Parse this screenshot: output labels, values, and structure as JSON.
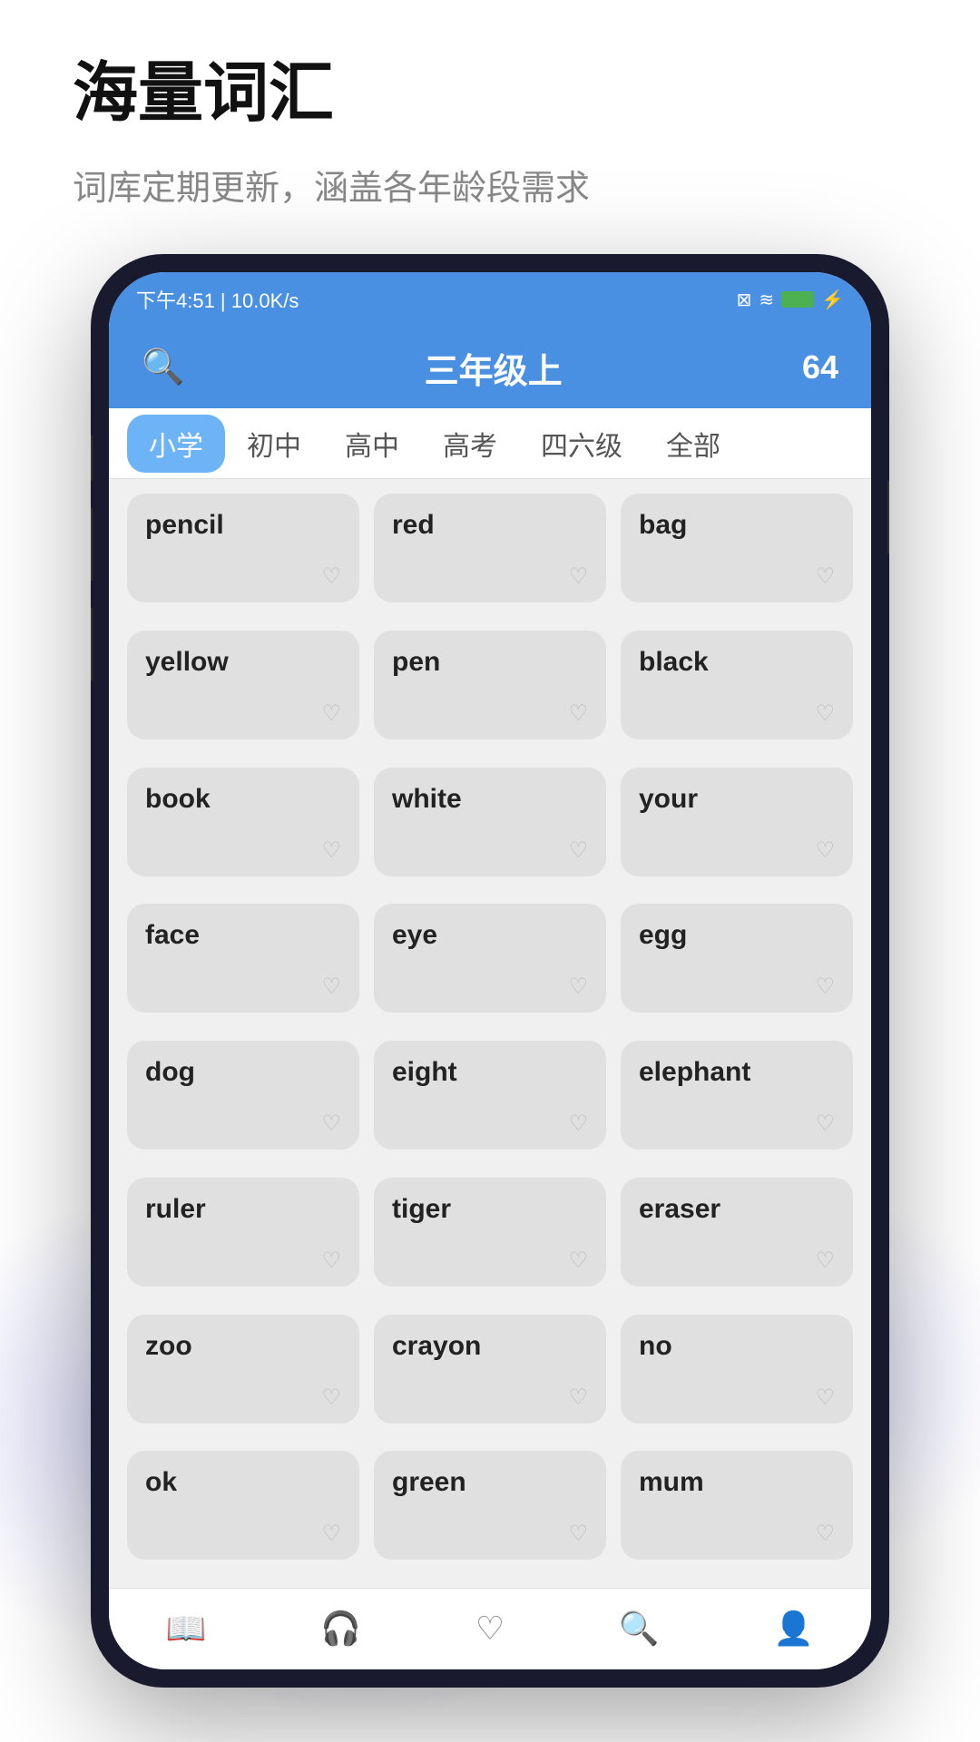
{
  "page": {
    "title": "海量词汇",
    "subtitle": "词库定期更新，涵盖各年龄段需求"
  },
  "statusBar": {
    "time": "下午4:51 | 10.0K/s",
    "icons": "⊠ ≋ 100"
  },
  "appHeader": {
    "title": "三年级上",
    "wordCount": "64",
    "searchLabel": "搜索"
  },
  "tabs": [
    {
      "label": "小学",
      "active": true
    },
    {
      "label": "初中",
      "active": false
    },
    {
      "label": "高中",
      "active": false
    },
    {
      "label": "高考",
      "active": false
    },
    {
      "label": "四六级",
      "active": false
    },
    {
      "label": "全部",
      "active": false
    }
  ],
  "words": [
    "pencil",
    "red",
    "bag",
    "yellow",
    "pen",
    "black",
    "book",
    "white",
    "your",
    "face",
    "eye",
    "egg",
    "dog",
    "eight",
    "elephant",
    "ruler",
    "tiger",
    "eraser",
    "zoo",
    "crayon",
    "no",
    "ok",
    "green",
    "mum"
  ],
  "bottomNav": [
    {
      "icon": "📖",
      "label": "词库",
      "active": true
    },
    {
      "icon": "🎧",
      "label": "听力",
      "active": false
    },
    {
      "icon": "♡",
      "label": "收藏",
      "active": false
    },
    {
      "icon": "🔍",
      "label": "拓展",
      "active": false
    },
    {
      "icon": "👤",
      "label": "我的",
      "active": false
    }
  ]
}
